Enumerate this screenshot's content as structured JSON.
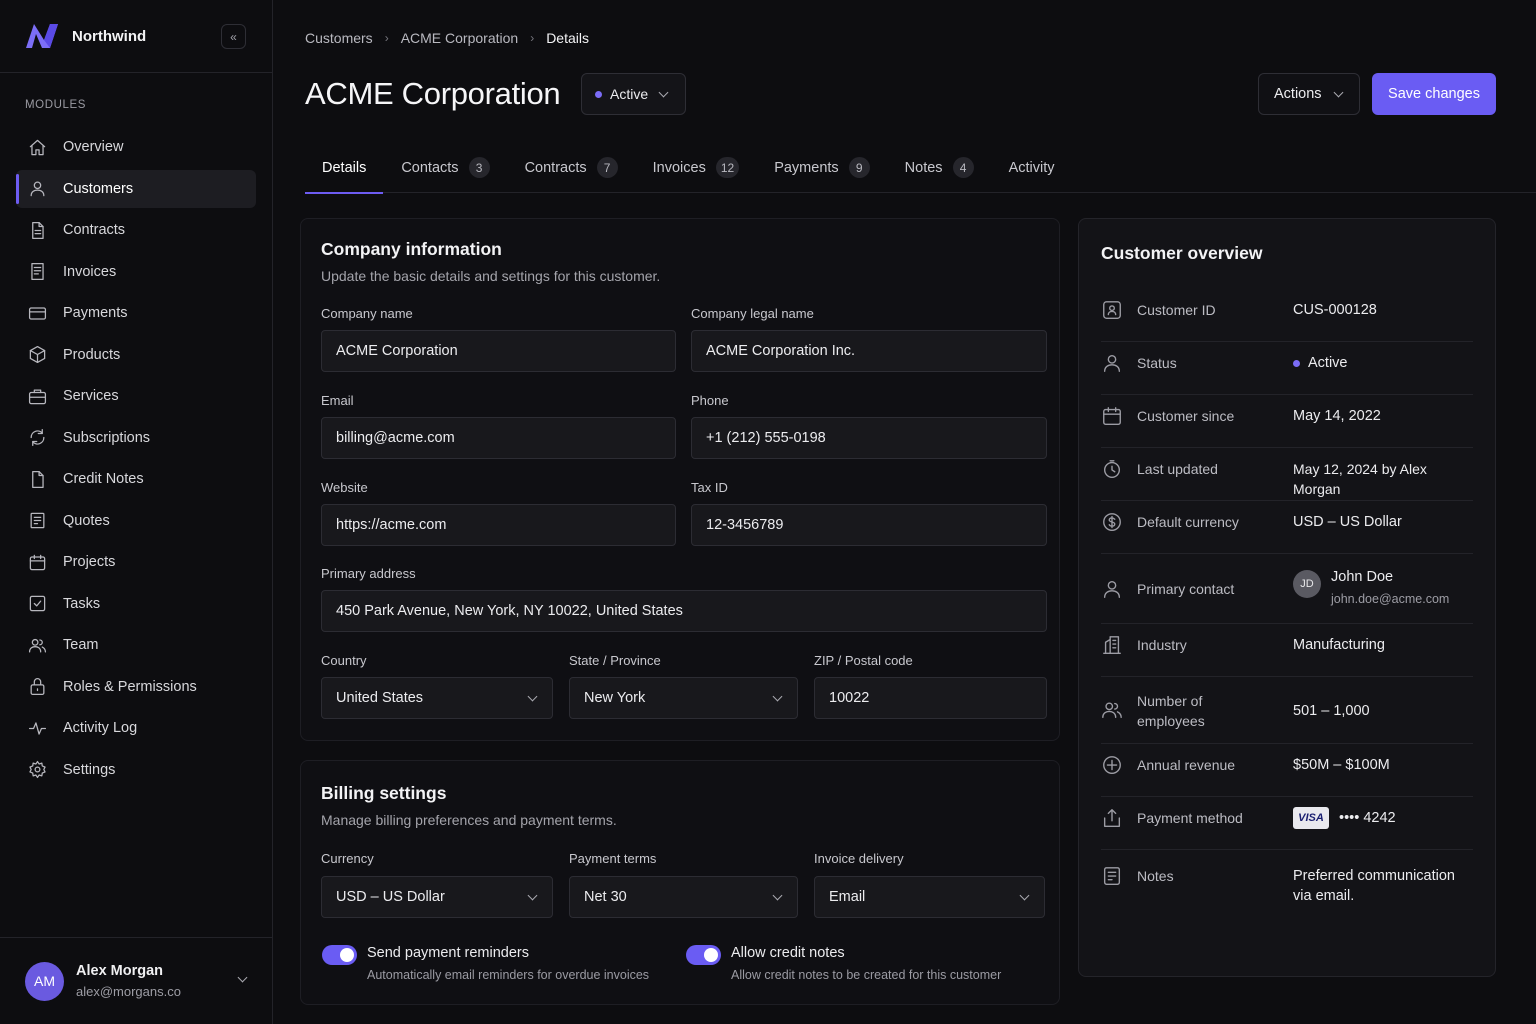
{
  "sidebar": {
    "brand": "Northwind",
    "section": "MODULES",
    "items": [
      {
        "label": "Overview",
        "icon": "home-icon"
      },
      {
        "label": "Customers",
        "icon": "user-icon"
      },
      {
        "label": "Contracts",
        "icon": "document-icon"
      },
      {
        "label": "Invoices",
        "icon": "invoice-icon"
      },
      {
        "label": "Payments",
        "icon": "credit-card-icon"
      },
      {
        "label": "Products",
        "icon": "box-icon"
      },
      {
        "label": "Services",
        "icon": "briefcase-icon"
      },
      {
        "label": "Subscriptions",
        "icon": "refresh-icon"
      },
      {
        "label": "Credit Notes",
        "icon": "file-icon"
      },
      {
        "label": "Quotes",
        "icon": "quote-icon"
      },
      {
        "label": "Projects",
        "icon": "calendar-icon"
      },
      {
        "label": "Tasks",
        "icon": "check-square-icon"
      },
      {
        "label": "Team",
        "icon": "users-icon"
      },
      {
        "label": "Roles & Permissions",
        "icon": "lock-icon"
      },
      {
        "label": "Activity Log",
        "icon": "pulse-icon"
      },
      {
        "label": "Settings",
        "icon": "gear-icon"
      }
    ],
    "active_index": 1,
    "user": {
      "initials": "AM",
      "name": "Alex Morgan",
      "email": "alex@morgans.co"
    }
  },
  "breadcrumb": [
    "Customers",
    "ACME Corporation",
    "Details"
  ],
  "header": {
    "title": "ACME Corporation",
    "status": "Active",
    "actions_label": "Actions",
    "save_label": "Save changes"
  },
  "tabs": [
    {
      "label": "Details",
      "count": ""
    },
    {
      "label": "Contacts",
      "count": "3"
    },
    {
      "label": "Contracts",
      "count": "7"
    },
    {
      "label": "Invoices",
      "count": "12"
    },
    {
      "label": "Payments",
      "count": "9"
    },
    {
      "label": "Notes",
      "count": "4"
    },
    {
      "label": "Activity",
      "count": ""
    }
  ],
  "company": {
    "title": "Company information",
    "subtitle": "Update the basic details and settings for this customer.",
    "fields": {
      "company_name": {
        "label": "Company name",
        "value": "ACME Corporation"
      },
      "legal_name": {
        "label": "Company legal name",
        "value": "ACME Corporation Inc."
      },
      "email": {
        "label": "Email",
        "value": "billing@acme.com"
      },
      "phone": {
        "label": "Phone",
        "value": "+1 (212) 555-0198"
      },
      "website": {
        "label": "Website",
        "value": "https://acme.com"
      },
      "tax_id": {
        "label": "Tax ID",
        "value": "12-3456789"
      },
      "address": {
        "label": "Primary address",
        "value": "450 Park Avenue, New York, NY 10022, United States"
      },
      "country": {
        "label": "Country",
        "value": "United States"
      },
      "state": {
        "label": "State / Province",
        "value": "New York"
      },
      "zip": {
        "label": "ZIP / Postal code",
        "value": "10022"
      }
    }
  },
  "billing": {
    "title": "Billing settings",
    "subtitle": "Manage billing preferences and payment terms.",
    "currency": {
      "label": "Currency",
      "value": "USD – US Dollar"
    },
    "terms": {
      "label": "Payment terms",
      "value": "Net 30"
    },
    "delivery": {
      "label": "Invoice delivery",
      "value": "Email"
    },
    "reminders": {
      "title": "Send payment reminders",
      "subtitle": "Automatically email reminders for overdue invoices",
      "enabled": true
    },
    "credit_notes": {
      "title": "Allow credit notes",
      "subtitle": "Allow credit notes to be created for this customer",
      "enabled": true
    }
  },
  "overview": {
    "title": "Customer overview",
    "customer_id": {
      "label": "Customer ID",
      "value": "CUS-000128"
    },
    "status": {
      "label": "Status",
      "value": "Active"
    },
    "since": {
      "label": "Customer since",
      "value": "May 14, 2022"
    },
    "updated": {
      "label": "Last updated",
      "value": "May 12, 2024 by Alex Morgan"
    },
    "currency": {
      "label": "Default currency",
      "value": "USD – US Dollar"
    },
    "contact": {
      "label": "Primary contact",
      "initials": "JD",
      "name": "John Doe",
      "email": "john.doe@acme.com"
    },
    "industry": {
      "label": "Industry",
      "value": "Manufacturing"
    },
    "employees": {
      "label": "Number of employees",
      "value": "501 – 1,000"
    },
    "revenue": {
      "label": "Annual revenue",
      "value": "$50M – $100M"
    },
    "payment": {
      "label": "Payment method",
      "brand": "VISA",
      "value": "•••• 4242"
    },
    "notes": {
      "label": "Notes",
      "value": "Preferred communication via email."
    }
  },
  "colors": {
    "accent": "#6a5cf3",
    "background": "#0d0d10",
    "surface": "#18181c"
  }
}
